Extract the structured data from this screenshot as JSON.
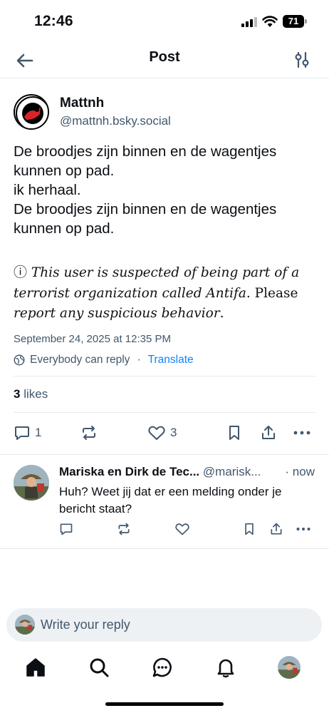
{
  "status_bar": {
    "time": "12:46",
    "battery": "71"
  },
  "header": {
    "title": "Post"
  },
  "post": {
    "author_name": "Mattnh",
    "author_handle": "@mattnh.bsky.social",
    "lines": [
      "De broodjes zijn binnen en de wagentjes",
      "kunnen op pad.",
      "ik herhaal.",
      "De broodjes zijn binnen en de wagentjes",
      "kunnen op pad."
    ],
    "notice": {
      "glyph": "ⓘ",
      "line1": "This user is suspected of being part of a",
      "line2": "terrorist organization called Antifa",
      "line2_end": ". Please",
      "line3": "report any suspicious behavior",
      "line3_end": "."
    },
    "date": "September 24, 2025 at 12:35 PM",
    "reply_setting": "Everybody can reply",
    "separator": "·",
    "translate_label": "Translate",
    "likes_count": "3",
    "likes_label": "likes",
    "reply_count": "1",
    "like_count_action": "3"
  },
  "reply": {
    "name": "Mariska en Dirk de Tec...",
    "handle": "@marisk...",
    "time": "· now",
    "text": "Huh? Weet jij dat er een melding onder je bericht staat?"
  },
  "composer": {
    "placeholder": "Write your reply"
  },
  "colors": {
    "accent": "#1083fe",
    "muted": "#42576c",
    "divider": "#e6eaef"
  },
  "icons": [
    "back-arrow-icon",
    "sliders-icon",
    "globe-icon",
    "reply-icon",
    "repost-icon",
    "heart-icon",
    "bookmark-icon",
    "share-icon",
    "more-icon",
    "home-icon",
    "search-icon",
    "chat-icon",
    "bell-icon"
  ]
}
